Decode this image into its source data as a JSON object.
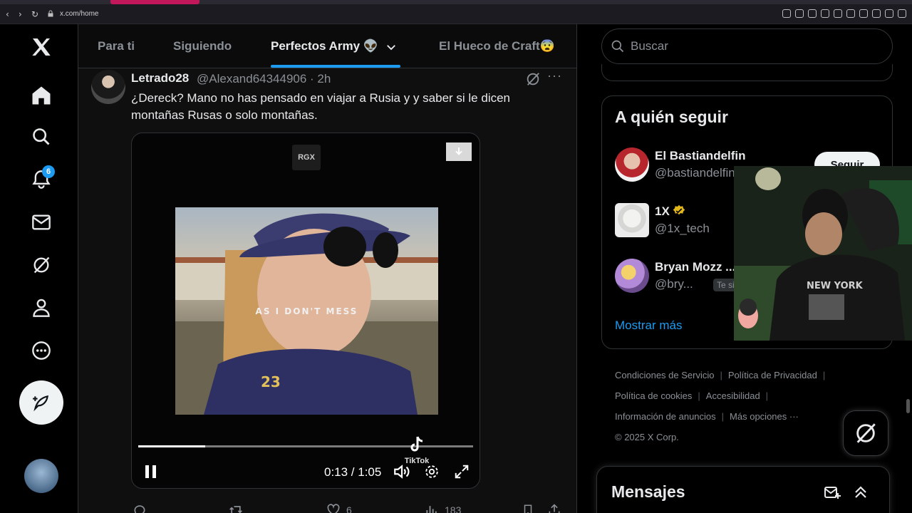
{
  "browser": {
    "url": "x.com/home"
  },
  "nav": {
    "notifications_badge": "6",
    "items": [
      "home",
      "explore",
      "notifications",
      "messages",
      "grok",
      "profile",
      "more"
    ]
  },
  "tabs": [
    {
      "label": "Para ti"
    },
    {
      "label": "Siguiendo"
    },
    {
      "label": "Perfectos Army 👽"
    },
    {
      "label": "El Hueco de Craft😨"
    }
  ],
  "tweet": {
    "name": "Letrado28",
    "handle": "@Alexand64344906 · 2h",
    "text": "¿Dereck? Mano no has pensado en viajar a Rusia y y saber si le dicen montañas Rusas o solo montañas.",
    "video": {
      "watermark": "RGX",
      "caption": "AS I DON'T MESS",
      "time": "0:13 / 1:05",
      "progress": 0.2,
      "tiktok_label": "TikTok"
    },
    "likes": "6",
    "views": "183"
  },
  "sidebar": {
    "search_placeholder": "Buscar",
    "who_to_follow_title": "A quién seguir",
    "users": [
      {
        "name": "El Bastiandelfin",
        "handle": "@bastiandelfin",
        "button": "Seguir"
      },
      {
        "name": "1X",
        "handle": "@1x_tech",
        "verified": true
      },
      {
        "name": "Bryan Mozz ...",
        "handle": "@bry...",
        "follows_you": "Te sigue"
      }
    ],
    "show_more": "Mostrar más",
    "footer": {
      "terms": "Condiciones de Servicio",
      "privacy": "Política de Privacidad",
      "cookies": "Política de cookies",
      "accessibility": "Accesibilidad",
      "ads": "Información de anuncios",
      "more": "Más opciones ···",
      "copyright": "© 2025 X Corp."
    },
    "messages_title": "Mensajes"
  },
  "colors": {
    "accent": "#1d9bf0",
    "background": "#000000",
    "muted": "#8b9096",
    "verified_gold": "#e2b719"
  }
}
